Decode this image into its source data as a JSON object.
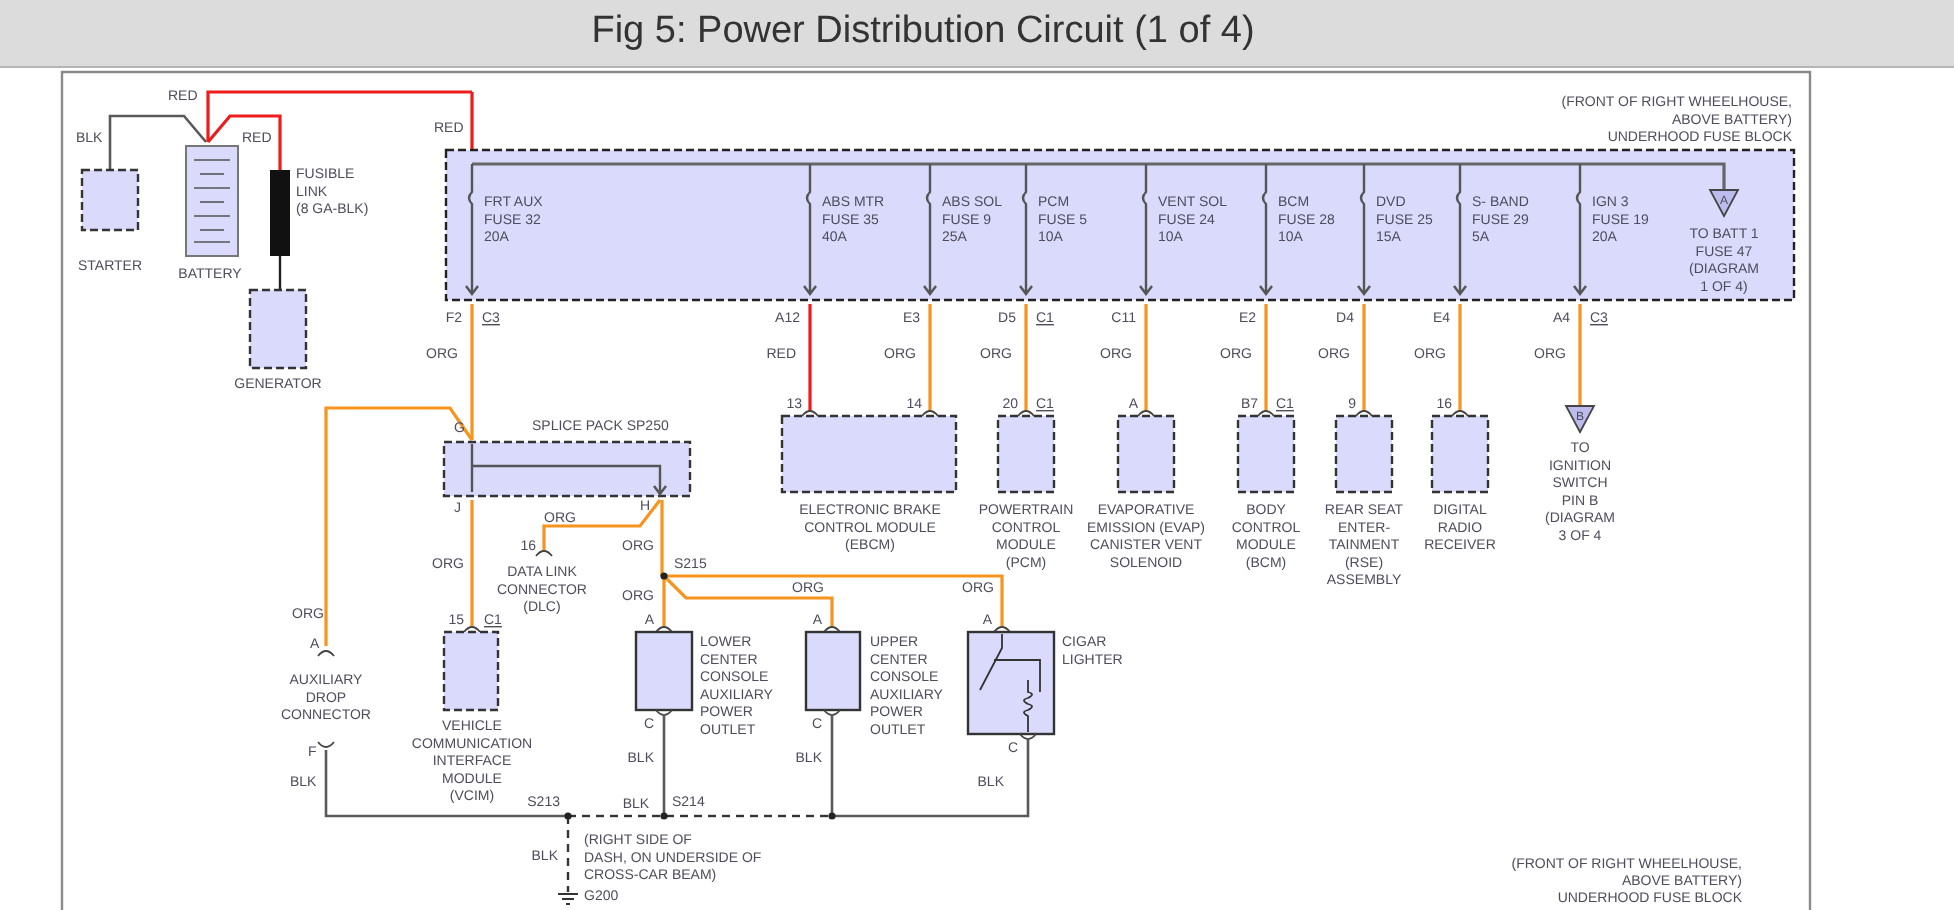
{
  "page": {
    "title": "Fig 5: Power Distribution Circuit (1 of 4)"
  },
  "battery_circuit": {
    "starter": "STARTER",
    "battery": "BATTERY",
    "fusible_link": [
      "FUSIBLE",
      "LINK",
      "(8 GA-BLK)"
    ],
    "generator": "GENERATOR",
    "wires": [
      {
        "label": "BLK",
        "color": "#595959"
      },
      {
        "label": "RED",
        "color": "#ee1c1c"
      },
      {
        "label": "RED",
        "color": "#ee1c1c"
      },
      {
        "label": "RED",
        "color": "#ee1c1c"
      }
    ]
  },
  "fuse_block": {
    "location": [
      "(FRONT OF RIGHT WHEELHOUSE,",
      "ABOVE BATTERY)",
      "UNDERHOOD FUSE BLOCK"
    ],
    "fuses": [
      {
        "label": [
          "FRT AUX",
          "FUSE 32",
          "20A"
        ],
        "pin": "F2",
        "connector": "C3",
        "wire": {
          "label": "ORG",
          "color": "#f7941d"
        }
      },
      {
        "label": [
          "ABS MTR",
          "FUSE 35",
          "40A"
        ],
        "pin": "A12",
        "wire": {
          "label": "RED",
          "color": "#ee1c1c"
        }
      },
      {
        "label": [
          "ABS SOL",
          "FUSE 9",
          "25A"
        ],
        "pin": "E3",
        "wire": {
          "label": "ORG",
          "color": "#f7941d"
        }
      },
      {
        "label": [
          "PCM",
          "FUSE 5",
          "10A"
        ],
        "pin": "D5",
        "connector": "C1",
        "wire": {
          "label": "ORG",
          "color": "#f7941d"
        }
      },
      {
        "label": [
          "VENT SOL",
          "FUSE 24",
          "10A"
        ],
        "pin": "C11",
        "wire": {
          "label": "ORG",
          "color": "#f7941d"
        }
      },
      {
        "label": [
          "BCM",
          "FUSE 28",
          "10A"
        ],
        "pin": "E2",
        "wire": {
          "label": "ORG",
          "color": "#f7941d"
        }
      },
      {
        "label": [
          "DVD",
          "FUSE 25",
          "15A"
        ],
        "pin": "D4",
        "wire": {
          "label": "ORG",
          "color": "#f7941d"
        }
      },
      {
        "label": [
          "S- BAND",
          "FUSE 29",
          "5A"
        ],
        "pin": "E4",
        "wire": {
          "label": "ORG",
          "color": "#f7941d"
        }
      },
      {
        "label": [
          "IGN 3",
          "FUSE 19",
          "20A"
        ],
        "pin": "A4",
        "connector": "C3",
        "wire": {
          "label": "ORG",
          "color": "#f7941d"
        }
      }
    ],
    "off_page": {
      "letter": "A",
      "label": [
        "TO BATT 1",
        "FUSE 47",
        "(DIAGRAM",
        "1 OF 4)"
      ]
    }
  },
  "modules": [
    {
      "label": [
        "ELECTRONIC BRAKE",
        "CONTROL MODULE",
        "(EBCM)"
      ],
      "pins": [
        {
          "number": "13"
        },
        {
          "number": "14"
        }
      ]
    },
    {
      "label": [
        "POWERTRAIN",
        "CONTROL",
        "MODULE",
        "(PCM)"
      ],
      "pins": [
        {
          "number": "20",
          "connector": "C1"
        }
      ]
    },
    {
      "label": [
        "EVAPORATIVE",
        "EMISSION (EVAP)",
        "CANISTER VENT",
        "SOLENOID"
      ],
      "pins": [
        {
          "number": "A"
        }
      ]
    },
    {
      "label": [
        "BODY",
        "CONTROL",
        "MODULE",
        "(BCM)"
      ],
      "pins": [
        {
          "number": "B7",
          "connector": "C1"
        }
      ]
    },
    {
      "label": [
        "REAR SEAT",
        "ENTER-",
        "TAINMENT",
        "(RSE)",
        "ASSEMBLY"
      ],
      "pins": [
        {
          "number": "9"
        }
      ]
    },
    {
      "label": [
        "DIGITAL",
        "RADIO",
        "RECEIVER"
      ],
      "pins": [
        {
          "number": "16"
        }
      ]
    }
  ],
  "ignition_ref": {
    "letter": "B",
    "label": [
      "TO",
      "IGNITION",
      "SWITCH",
      "PIN B",
      "(DIAGRAM",
      "3 OF 4"
    ]
  },
  "splice_pack": {
    "name": "SPLICE PACK SP250",
    "pins": [
      "G",
      "J",
      "H"
    ]
  },
  "aux_drop": {
    "label": [
      "AUXILIARY",
      "DROP",
      "CONNECTOR"
    ],
    "pin_in": "A",
    "pin_out": "F",
    "wire_in": {
      "label": "ORG",
      "color": "#f7941d"
    },
    "wire_out": {
      "label": "BLK",
      "color": "#595959"
    }
  },
  "vcim": {
    "label": [
      "VEHICLE",
      "COMMUNICATION",
      "INTERFACE",
      "MODULE",
      "(VCIM)"
    ],
    "pin": "15",
    "connector": "C1",
    "wire": {
      "label": "ORG",
      "color": "#f7941d"
    }
  },
  "dlc": {
    "label": [
      "DATA LINK",
      "CONNECTOR",
      "(DLC)"
    ],
    "pin": "16",
    "wire": {
      "label": "ORG",
      "color": "#f7941d"
    }
  },
  "s215": {
    "name": "S215",
    "wire": {
      "label": "ORG",
      "color": "#f7941d"
    }
  },
  "outlets": [
    {
      "kind": "outlet",
      "label": [
        "LOWER",
        "CENTER",
        "CONSOLE",
        "AUXILIARY",
        "POWER",
        "OUTLET"
      ],
      "pin_in": "A",
      "pin_out": "C",
      "wire_in": {
        "label": "ORG",
        "color": "#f7941d"
      },
      "wire_out": {
        "label": "BLK",
        "color": "#595959"
      }
    },
    {
      "kind": "outlet",
      "label": [
        "UPPER",
        "CENTER",
        "CONSOLE",
        "AUXILIARY",
        "POWER",
        "OUTLET"
      ],
      "pin_in": "A",
      "pin_out": "C",
      "wire_in": {
        "label": "ORG",
        "color": "#f7941d"
      },
      "wire_out": {
        "label": "BLK",
        "color": "#595959"
      }
    },
    {
      "kind": "lighter",
      "label": [
        "CIGAR",
        "LIGHTER"
      ],
      "pin_in": "A",
      "pin_out": "C",
      "wire_in": {
        "label": "ORG",
        "color": "#f7941d"
      },
      "wire_out": {
        "label": "BLK",
        "color": "#595959"
      }
    }
  ],
  "ground": {
    "splices": [
      "S213",
      "S214"
    ],
    "bus_wire": {
      "label": "BLK",
      "color": "#333333"
    },
    "drop_wire": {
      "label": "BLK",
      "color": "#333333"
    },
    "location": [
      "(RIGHT SIDE OF",
      "DASH, ON UNDERSIDE OF",
      "CROSS-CAR BEAM)"
    ],
    "name": "G200"
  },
  "footer_location": [
    "(FRONT OF RIGHT WHEELHOUSE,",
    "ABOVE BATTERY)",
    "UNDERHOOD FUSE BLOCK"
  ]
}
